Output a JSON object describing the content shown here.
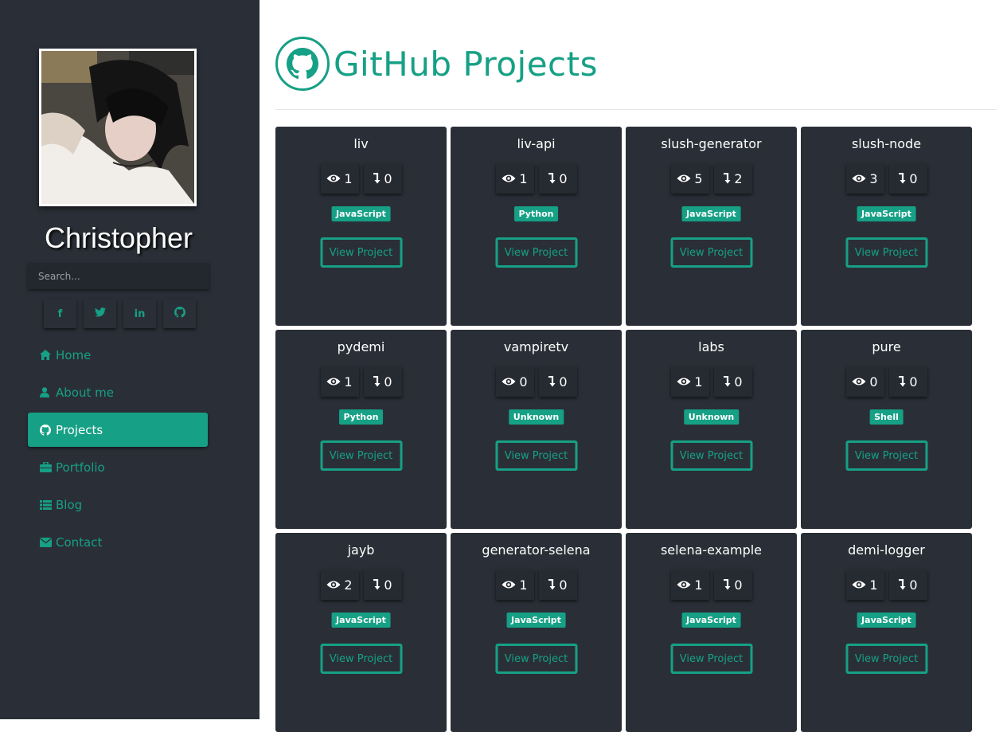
{
  "sidebar": {
    "name": "Christopher",
    "search_placeholder": "Search...",
    "socials": [
      {
        "icon": "facebook-icon",
        "glyph": "f"
      },
      {
        "icon": "twitter-icon",
        "glyph": "t"
      },
      {
        "icon": "linkedin-icon",
        "glyph": "in"
      },
      {
        "icon": "github-icon",
        "glyph": ""
      }
    ],
    "nav": [
      {
        "label": "Home",
        "icon": "home-icon"
      },
      {
        "label": "About me",
        "icon": "user-icon"
      },
      {
        "label": "Projects",
        "icon": "github-icon",
        "active": true
      },
      {
        "label": "Portfolio",
        "icon": "briefcase-icon"
      },
      {
        "label": "Blog",
        "icon": "list-icon"
      },
      {
        "label": "Contact",
        "icon": "envelope-icon"
      }
    ]
  },
  "main": {
    "title": "GitHub Projects",
    "view_label": "View Project",
    "projects": [
      {
        "name": "liv",
        "watchers": "1",
        "forks": "0",
        "language": "JavaScript"
      },
      {
        "name": "liv-api",
        "watchers": "1",
        "forks": "0",
        "language": "Python"
      },
      {
        "name": "slush-generator",
        "watchers": "5",
        "forks": "2",
        "language": "JavaScript"
      },
      {
        "name": "slush-node",
        "watchers": "3",
        "forks": "0",
        "language": "JavaScript"
      },
      {
        "name": "pydemi",
        "watchers": "1",
        "forks": "0",
        "language": "Python"
      },
      {
        "name": "vampiretv",
        "watchers": "0",
        "forks": "0",
        "language": "Unknown"
      },
      {
        "name": "labs",
        "watchers": "1",
        "forks": "0",
        "language": "Unknown"
      },
      {
        "name": "pure",
        "watchers": "0",
        "forks": "0",
        "language": "Shell"
      },
      {
        "name": "jayb",
        "watchers": "2",
        "forks": "0",
        "language": "JavaScript"
      },
      {
        "name": "generator-selena",
        "watchers": "1",
        "forks": "0",
        "language": "JavaScript"
      },
      {
        "name": "selena-example",
        "watchers": "1",
        "forks": "0",
        "language": "JavaScript"
      },
      {
        "name": "demi-logger",
        "watchers": "1",
        "forks": "0",
        "language": "JavaScript"
      }
    ]
  },
  "colors": {
    "accent": "#16a085",
    "sidebar_bg": "#2a2f37",
    "card_bg": "#2a2f37"
  }
}
